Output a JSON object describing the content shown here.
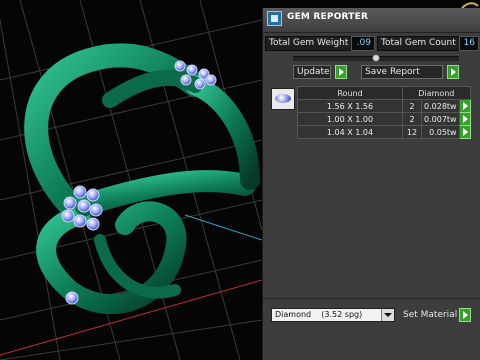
{
  "panel": {
    "title": "GEM REPORTER",
    "total_weight_label": "Total Gem Weight",
    "total_weight_value": ".09",
    "total_count_label": "Total Gem Count",
    "total_count_value": "16",
    "update_label": "Update",
    "save_report_label": "Save Report",
    "table": {
      "headers": [
        "Round",
        "Diamond"
      ],
      "rows": [
        {
          "size": "1.56 X 1.56",
          "count": "2",
          "weight": "0.028tw"
        },
        {
          "size": "1.00 X 1.00",
          "count": "2",
          "weight": "0.007tw"
        },
        {
          "size": "1.04 X 1.04",
          "count": "12",
          "weight": "0.05tw"
        }
      ]
    },
    "material_select": "Diamond    (3.52 spg)",
    "set_material_label": "Set Material"
  },
  "icons": {
    "app": "gem-reporter-app-icon",
    "gem_thumb": "round-diamond-icon",
    "go": "play-arrow-icon"
  },
  "colors": {
    "ring_green": "#0f8a62",
    "value_text": "#7fd6ff",
    "go_button": "#35a02a"
  }
}
